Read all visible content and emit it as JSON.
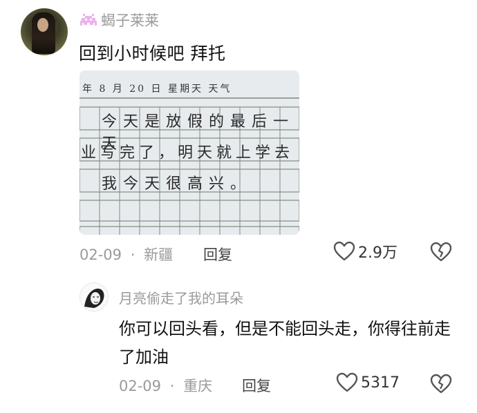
{
  "comments": [
    {
      "username": "蝎子莱莱",
      "text": "回到小时候吧 拜托",
      "date": "02-09",
      "sep": "·",
      "location": "新疆",
      "reply_label": "回复",
      "likes": "2.9万",
      "diary": {
        "header": "年 8 月 20 日 星期天 天气",
        "lines": [
          "今天是放假的最后一天",
          "业写完了，明天就上学去",
          "我今天很高兴。"
        ]
      }
    },
    {
      "username": "月亮偷走了我的耳朵",
      "text": "你可以回头看，但是不能回头走，你得往前走了加油",
      "date": "02-09",
      "sep": "·",
      "location": "重庆",
      "reply_label": "回复",
      "likes": "5317"
    }
  ]
}
